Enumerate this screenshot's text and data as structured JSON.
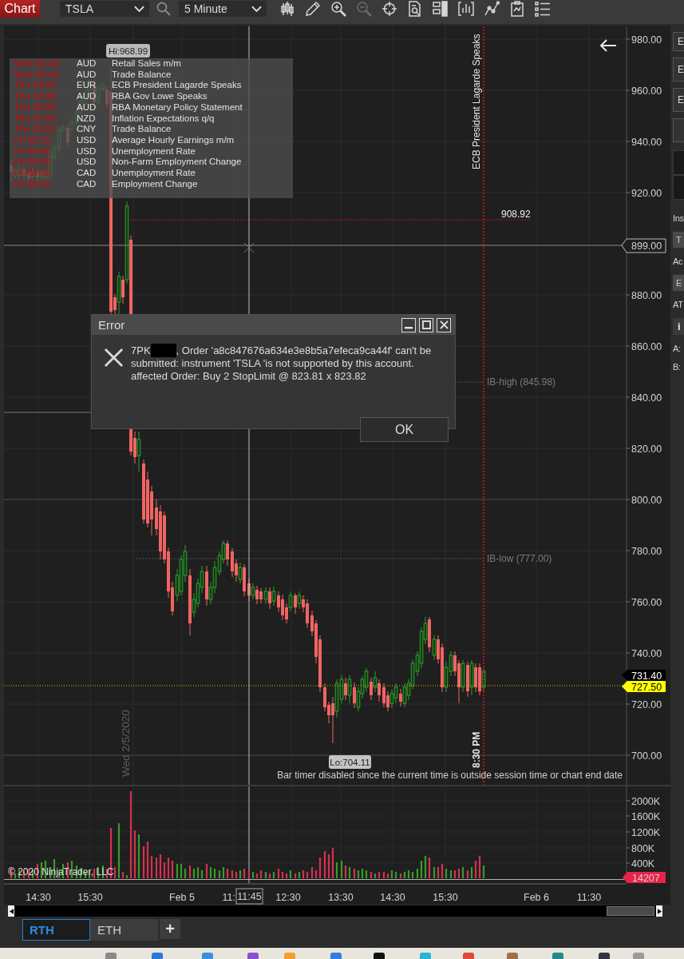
{
  "toolbar": {
    "title": "Chart",
    "instrument": "TSLA",
    "interval": "5 Minute",
    "tools": [
      {
        "kind": "candles",
        "disabled": false
      },
      {
        "kind": "pencil",
        "disabled": false
      },
      {
        "kind": "zoom_in",
        "disabled": false
      },
      {
        "kind": "zoom_out",
        "disabled": true
      },
      {
        "kind": "crosshair",
        "disabled": false
      },
      {
        "kind": "data_box",
        "disabled": false
      },
      {
        "kind": "panels",
        "disabled": false
      },
      {
        "kind": "indicators",
        "disabled": false
      },
      {
        "kind": "strategies",
        "disabled": false
      },
      {
        "kind": "properties",
        "disabled": false
      },
      {
        "kind": "list",
        "disabled": false
      }
    ]
  },
  "news": [
    {
      "time": "Wed 20:30",
      "currency": "AUD",
      "event": "Retail Sales m/m"
    },
    {
      "time": "Wed 20:30",
      "currency": "AUD",
      "event": "Trade Balance"
    },
    {
      "time": "Thu 04:00",
      "currency": "EUR",
      "event": "ECB President Lagarde Speaks"
    },
    {
      "time": "Thu 18:30",
      "currency": "AUD",
      "event": "RBA Gov Lowe Speaks"
    },
    {
      "time": "Thu 20:30",
      "currency": "AUD",
      "event": "RBA Monetary Policy Statement"
    },
    {
      "time": "Thu 22:00",
      "currency": "NZD",
      "event": "Inflation Expectations q/q"
    },
    {
      "time": "Thu 23:03",
      "currency": "CNY",
      "event": "Trade Balance"
    },
    {
      "time": "Fri 09:30",
      "currency": "USD",
      "event": "Average Hourly Earnings m/m"
    },
    {
      "time": "Fri 09:30",
      "currency": "USD",
      "event": "Unemployment Rate"
    },
    {
      "time": "Fri 09:30",
      "currency": "USD",
      "event": "Non-Farm Employment Change"
    },
    {
      "time": "Fri 09:30",
      "currency": "CAD",
      "event": "Unemployment Rate"
    },
    {
      "time": "Fri 09:30",
      "currency": "CAD",
      "event": "Employment Change"
    }
  ],
  "chart": {
    "hi_label": "Hi:968.99",
    "lo_label": "Lo:704.11",
    "price_labels": [
      "980.00",
      "960.00",
      "940.00",
      "920.00",
      "880.00",
      "860.00",
      "840.00",
      "820.00",
      "800.00",
      "780.00",
      "760.00",
      "740.00",
      "720.00",
      "700.00"
    ],
    "crosshair_price": "899.00",
    "level_label": "908.92",
    "price_markers": [
      {
        "text": "731.40",
        "color": "#000000"
      },
      {
        "text": "727.50",
        "color": "#ffff00"
      }
    ],
    "ib_high": "IB-high (845.98)",
    "ib_low": "IB-low (777.00)",
    "event_labels": [
      "ECB President Lagarde Speaks",
      "8:30 PM"
    ],
    "date_label": "Wed 2/5/2020",
    "bar_timer_note": "Bar timer disabled since the current time is outside session time or chart end date"
  },
  "volume": {
    "labels": [
      "2000K",
      "1600K",
      "1200K",
      "800K",
      "400K"
    ],
    "last_volume": "14207",
    "copyright": "© 2020 NinjaTrader, LLC"
  },
  "time_axis": {
    "labels": [
      "14:30",
      "15:30",
      "Feb 5",
      "11:",
      "12:30",
      "13:30",
      "14:30",
      "15:30",
      "Feb 6",
      "11:30"
    ],
    "crosshair_time": "11:45"
  },
  "session_tabs": [
    {
      "label": "RTH",
      "selected": true
    },
    {
      "label": "ETH",
      "selected": false
    }
  ],
  "add_tab": "+",
  "side_panel": [
    {
      "kind": "button",
      "text": "E"
    },
    {
      "kind": "button",
      "text": "E"
    },
    {
      "kind": "button",
      "text": "E"
    },
    {
      "kind": "button"
    },
    {
      "kind": "display"
    },
    {
      "kind": "display"
    },
    {
      "kind": "label",
      "text": "Ins"
    },
    {
      "kind": "field",
      "text": "T"
    },
    {
      "kind": "label",
      "text": "Ac"
    },
    {
      "kind": "field",
      "text": "E"
    },
    {
      "kind": "label",
      "text": "AT"
    },
    {
      "kind": "info",
      "text": "i"
    },
    {
      "kind": "label",
      "text": "A:"
    },
    {
      "kind": "label",
      "text": "B:"
    }
  ],
  "error_dialog": {
    "title": "Error",
    "message": {
      "prefix": "7PK",
      "redacted": true,
      "text": ", Order 'a8c847676a634e3e8b5a7efeca9ca44f' can't be submitted: instrument 'TSLA 'is not supported by this account. affected Order: Buy 2 StopLimit @ 823.81 x 823.82"
    },
    "button": "OK"
  }
}
